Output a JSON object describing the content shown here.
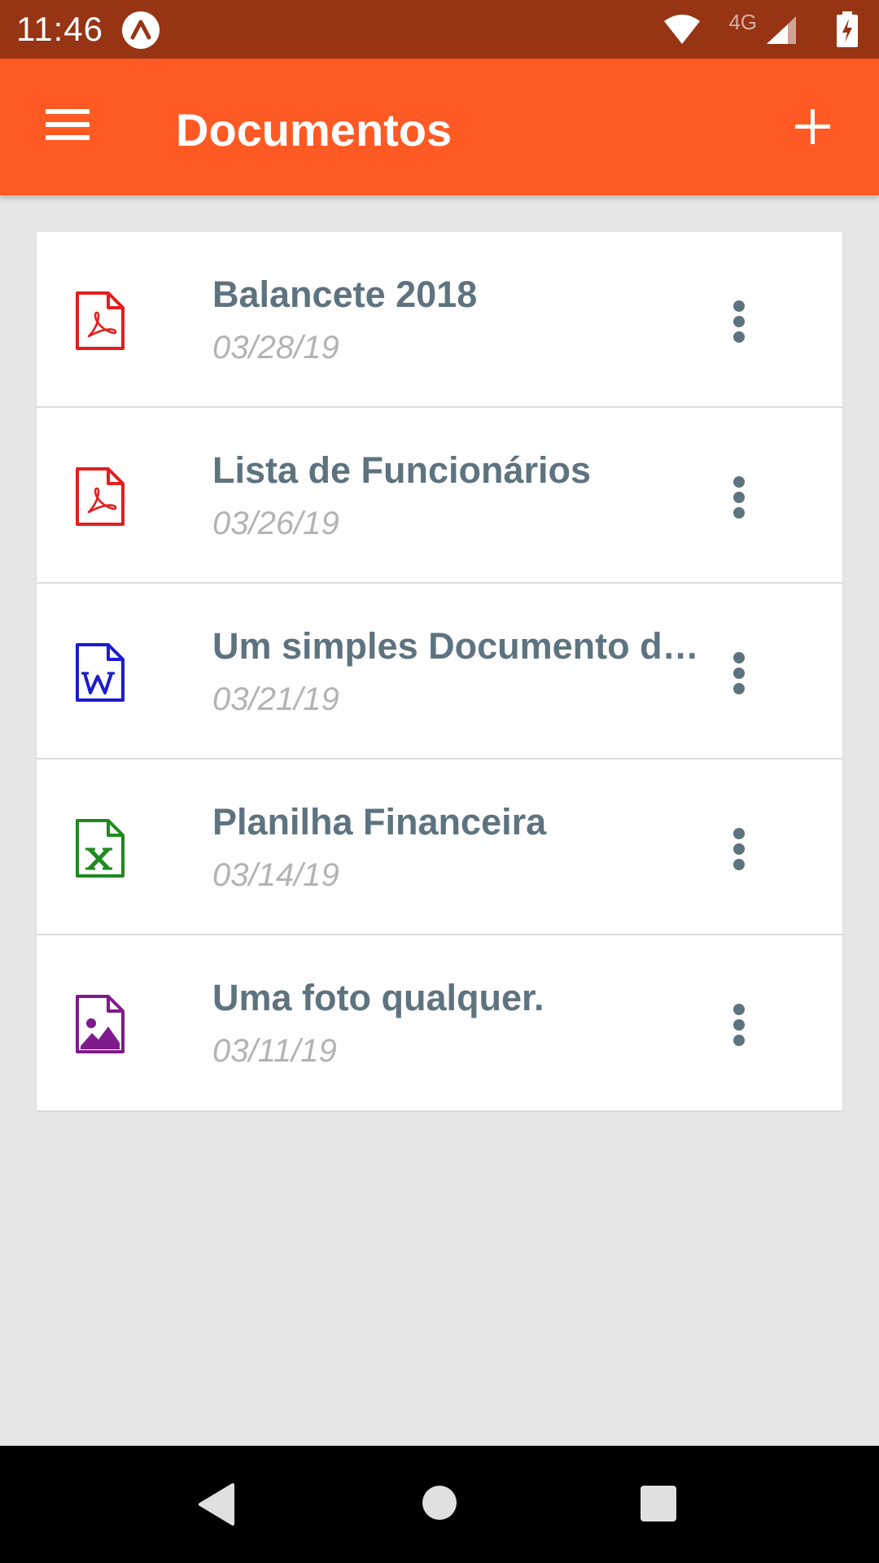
{
  "status_bar": {
    "time": "11:46",
    "network_label": "4G",
    "icons": [
      "app-notification-icon",
      "wifi-icon",
      "cellular-signal-icon",
      "battery-charging-icon"
    ]
  },
  "app_bar": {
    "title": "Documentos",
    "menu_icon": "hamburger-menu-icon",
    "add_icon": "plus-icon",
    "color": "#ff5a24"
  },
  "documents": [
    {
      "title": "Balancete 2018",
      "date": "03/28/19",
      "type": "pdf",
      "icon_color": "#e31e1e"
    },
    {
      "title": "Lista de Funcionários",
      "date": "03/26/19",
      "type": "pdf",
      "icon_color": "#e31e1e"
    },
    {
      "title": "Um simples Documento do Word",
      "date": "03/21/19",
      "type": "word",
      "icon_color": "#1c1ccf"
    },
    {
      "title": "Planilha Financeira",
      "date": "03/14/19",
      "type": "excel",
      "icon_color": "#1e8a1e"
    },
    {
      "title": "Uma foto qualquer.",
      "date": "03/11/19",
      "type": "image",
      "icon_color": "#7f1a8c"
    }
  ],
  "nav_bar": {
    "icons": [
      "back-icon",
      "home-icon",
      "recents-icon"
    ]
  },
  "colors": {
    "status_bar": "#963414",
    "background": "#e6e6e6",
    "title_text": "#5e7380",
    "date_text": "#b3b3b3"
  }
}
